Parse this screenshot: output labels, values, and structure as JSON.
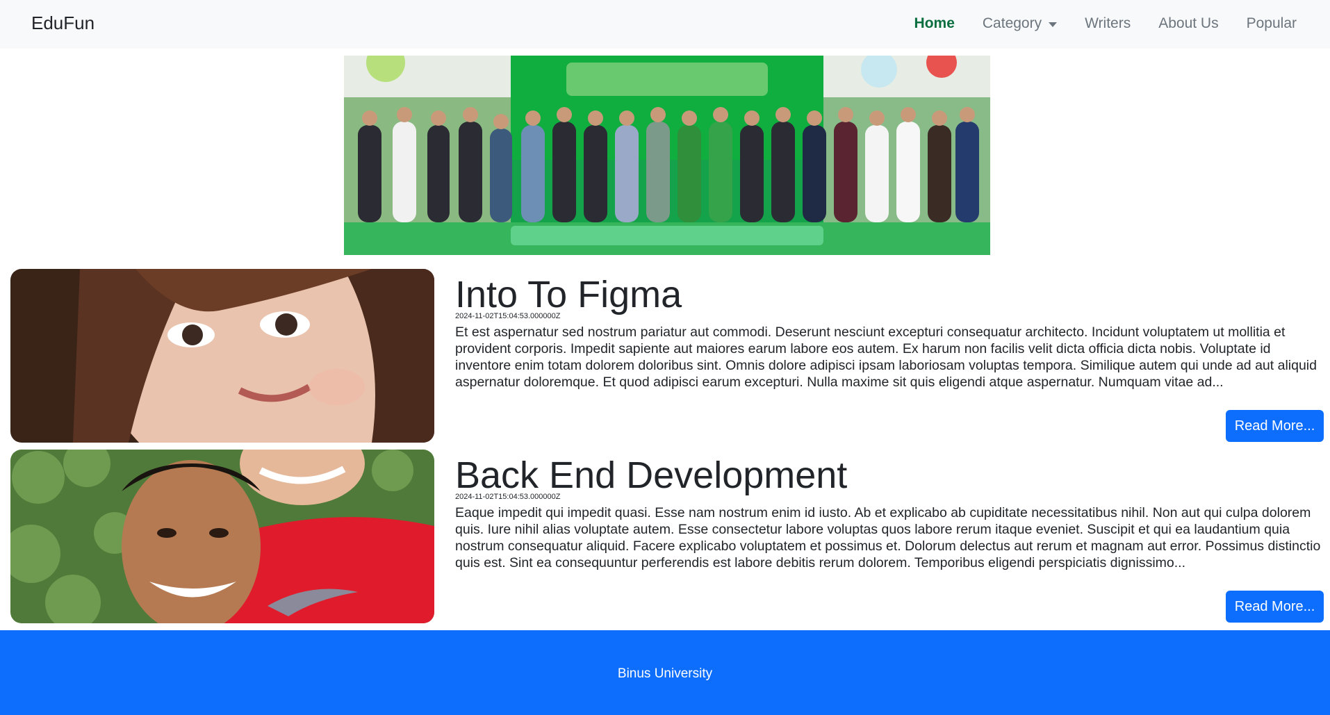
{
  "navbar": {
    "brand": "EduFun",
    "links": [
      {
        "label": "Home"
      },
      {
        "label": "Category"
      },
      {
        "label": "Writers"
      },
      {
        "label": "About Us"
      },
      {
        "label": "Popular"
      }
    ]
  },
  "articles": [
    {
      "title": "Into To Figma",
      "date": "2024-11-02T15:04:53.000000Z",
      "description": "Et est aspernatur sed nostrum pariatur aut commodi. Deserunt nesciunt excepturi consequatur architecto. Incidunt voluptatem ut mollitia et provident corporis. Impedit sapiente aut maiores earum labore eos autem. Ex harum non facilis velit dicta officia dicta nobis. Voluptate id inventore enim totam dolorem doloribus sint. Omnis dolore adipisci ipsam laboriosam voluptas tempora. Similique autem qui unde ad aut aliquid aspernatur doloremque. Et quod adipisci earum excepturi. Nulla maxime sit quis eligendi atque aspernatur. Numquam vitae ad...",
      "button": "Read More..."
    },
    {
      "title": "Back End Development",
      "date": "2024-11-02T15:04:53.000000Z",
      "description": "Eaque impedit qui impedit quasi. Esse nam nostrum enim id iusto. Ab et explicabo ab cupiditate necessitatibus nihil. Non aut qui culpa dolorem quis. Iure nihil alias voluptate autem. Esse consectetur labore voluptas quos labore rerum itaque eveniet. Suscipit et qui ea laudantium quia nostrum consequatur aliquid. Facere explicabo voluptatem et possimus et. Dolorum delectus aut rerum et magnam aut error. Possimus distinctio quis est. Sint ea consequuntur perferendis est labore debitis rerum dolorem. Temporibus eligendi perspiciatis dignissimo...",
      "button": "Read More..."
    }
  ],
  "footer": {
    "text": "Binus University"
  },
  "colors": {
    "navbar_bg": "#f8f9fa",
    "active_link": "#0b6e3f",
    "primary": "#0d6efd"
  }
}
